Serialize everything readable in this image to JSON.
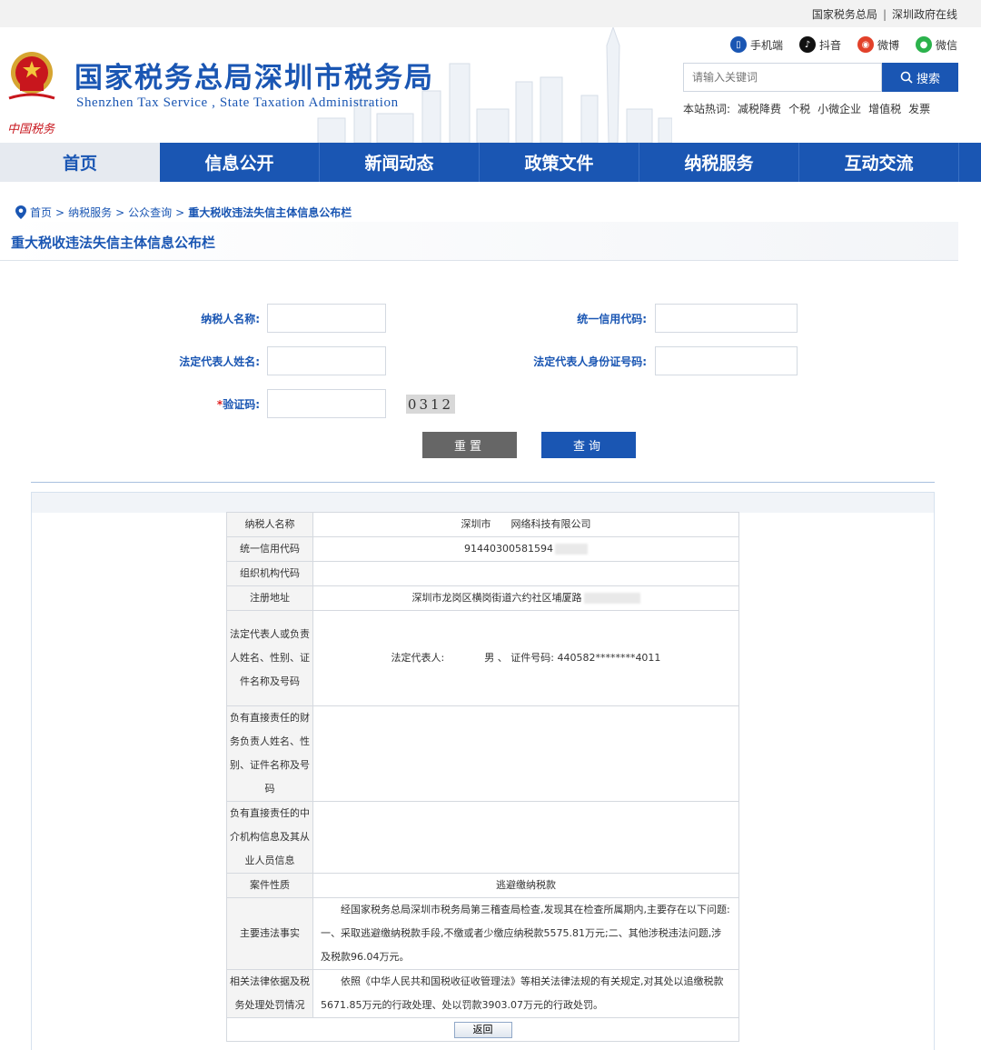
{
  "topbar": {
    "link1": "国家税务总局",
    "sep": "|",
    "link2": "深圳政府在线"
  },
  "header": {
    "emblem_text": "中国税务",
    "title": "国家税务总局深圳市税务局",
    "subtitle": "Shenzhen Tax Service , State Taxation Administration",
    "social": [
      {
        "label": "手机端",
        "icon": "mobile-icon",
        "color": "#1a56b3"
      },
      {
        "label": "抖音",
        "icon": "douyin-icon",
        "color": "#111111"
      },
      {
        "label": "微博",
        "icon": "weibo-icon",
        "color": "#e2412a"
      },
      {
        "label": "微信",
        "icon": "wechat-icon",
        "color": "#2bb24c"
      }
    ],
    "search_placeholder": "请输入关键词",
    "search_button": "搜索",
    "hot_label": "本站热词:",
    "hot_words": [
      "减税降费",
      "个税",
      "小微企业",
      "增值税",
      "发票"
    ]
  },
  "nav": [
    "首页",
    "信息公开",
    "新闻动态",
    "政策文件",
    "纳税服务",
    "互动交流"
  ],
  "breadcrumb": {
    "items": [
      "首页",
      "纳税服务",
      "公众查询"
    ],
    "current": "重大税收违法失信主体信息公布栏",
    "sep": ">"
  },
  "page_title": "重大税收违法失信主体信息公布栏",
  "form": {
    "taxpayer_name_label": "纳税人名称:",
    "credit_code_label": "统一信用代码:",
    "legal_rep_label": "法定代表人姓名:",
    "legal_rep_id_label": "法定代表人身份证号码:",
    "captcha_label": "验证码:",
    "required_mark": "*",
    "captcha_value": "0312",
    "reset_button": "重置",
    "query_button": "查询"
  },
  "result": {
    "rows": [
      {
        "k": "纳税人名称",
        "v": "深圳市　　网络科技有限公司"
      },
      {
        "k": "统一信用代码",
        "v": "91440300581594"
      },
      {
        "k": "组织机构代码",
        "v": ""
      },
      {
        "k": "注册地址",
        "v": "深圳市龙岗区横岗街道六约社区埔厦路"
      },
      {
        "k": "法定代表人或负责人姓名、性别、证件名称及号码",
        "v": "法定代表人:　　　　男 、 证件号码: 440582********4011"
      },
      {
        "k": "负有直接责任的财务负责人姓名、性别、证件名称及号码",
        "v": ""
      },
      {
        "k": "负有直接责任的中介机构信息及其从业人员信息",
        "v": ""
      },
      {
        "k": "案件性质",
        "v": "逃避缴纳税款"
      },
      {
        "k": "主要违法事实",
        "v": "经国家税务总局深圳市税务局第三稽查局检查,发现其在检查所属期内,主要存在以下问题:一、采取逃避缴纳税款手段,不缴或者少缴应纳税款5575.81万元;二、其他涉税违法问题,涉及税款96.04万元。"
      },
      {
        "k": "相关法律依据及税务处理处罚情况",
        "v": "依照《中华人民共和国税收征收管理法》等相关法律法规的有关规定,对其处以追缴税款5671.85万元的行政处理、处以罚款3903.07万元的行政处罚。"
      }
    ],
    "back_button": "返回"
  }
}
